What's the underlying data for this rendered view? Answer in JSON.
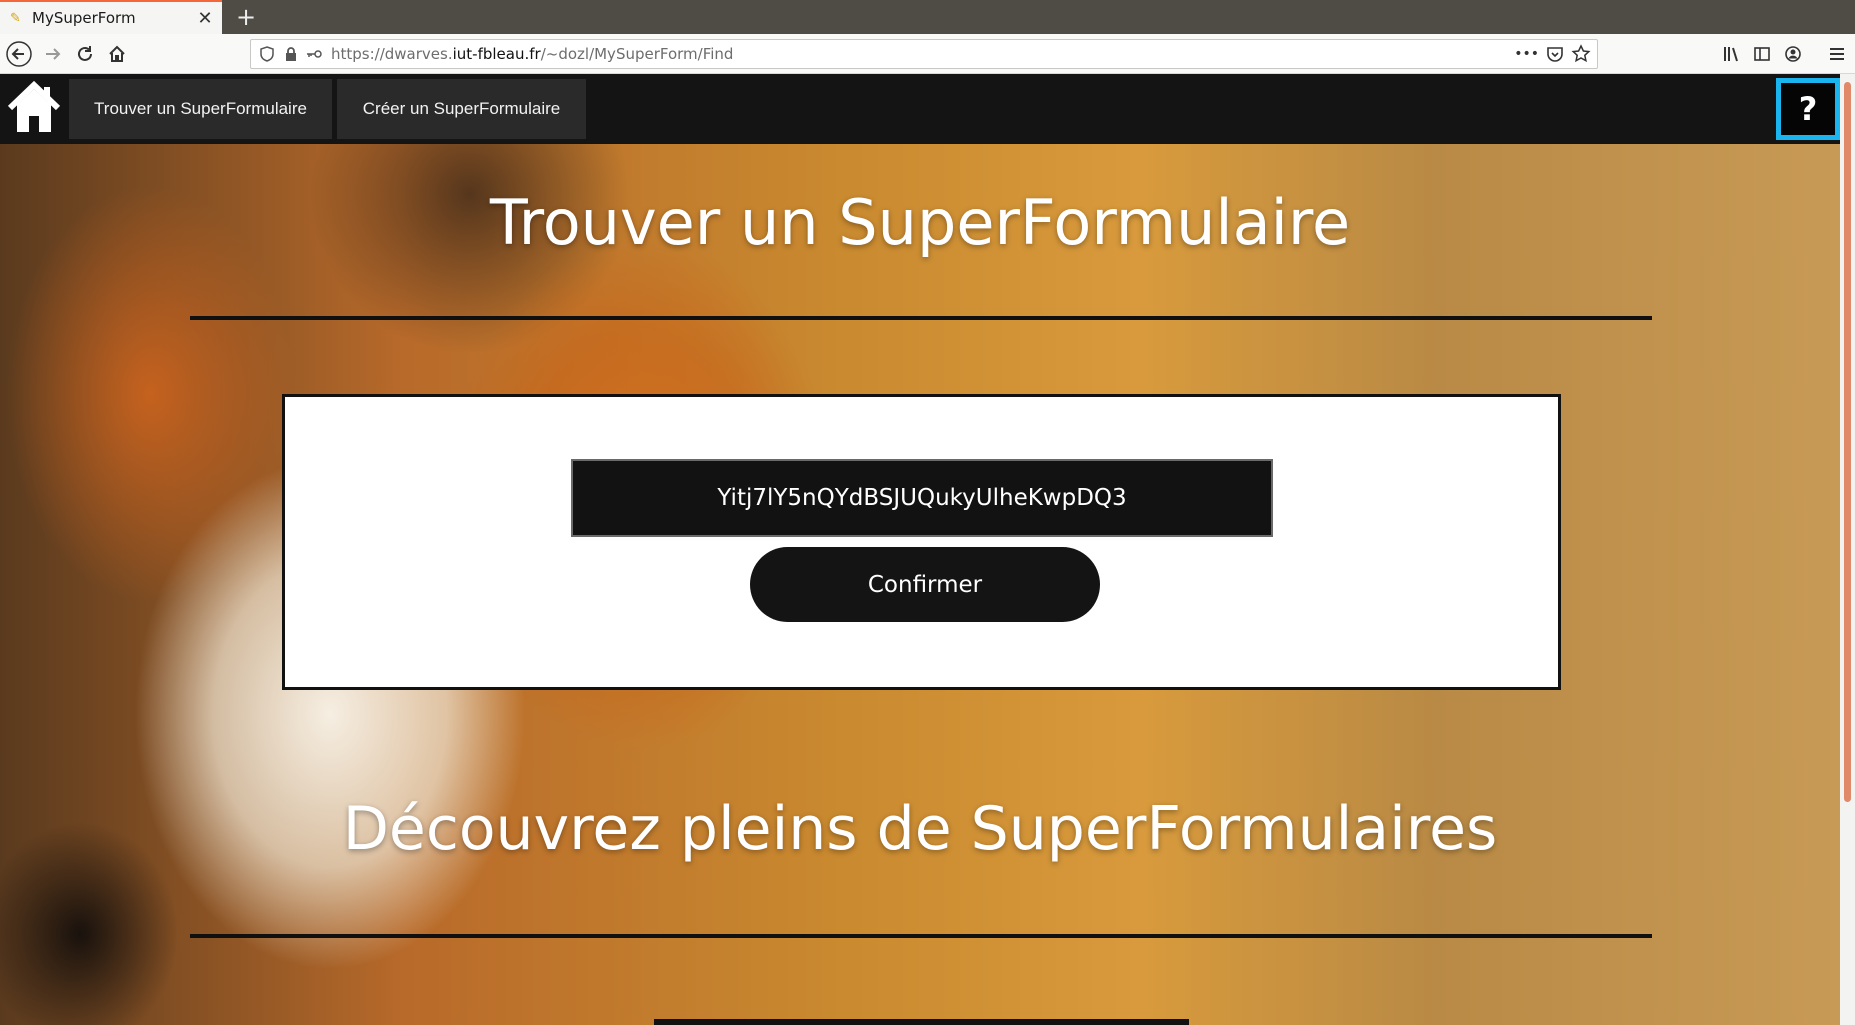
{
  "browser": {
    "tab_title": "MySuperForm",
    "tab_favicon": "pencil-icon",
    "new_tab_label": "+",
    "url": {
      "prefix": "https://dwarves.",
      "host": "iut-fbleau.fr",
      "path": "/~dozl/MySuperForm/Find"
    },
    "url_more": "•••"
  },
  "site_nav": {
    "home_icon": "house-icon",
    "links": [
      "Trouver un SuperFormulaire",
      "Créer un SuperFormulaire"
    ],
    "help_label": "?"
  },
  "main": {
    "title": "Trouver un SuperFormulaire",
    "code_value": "Yitj7lY5nQYdBSJUQukyUlheKwpDQ3",
    "confirm_label": "Confirmer",
    "section_title": "Découvrez pleins de SuperFormulaires"
  },
  "colors": {
    "help_border": "#1ab4ee",
    "nav_bg": "#141414",
    "tab_accent": "#f4673a"
  }
}
